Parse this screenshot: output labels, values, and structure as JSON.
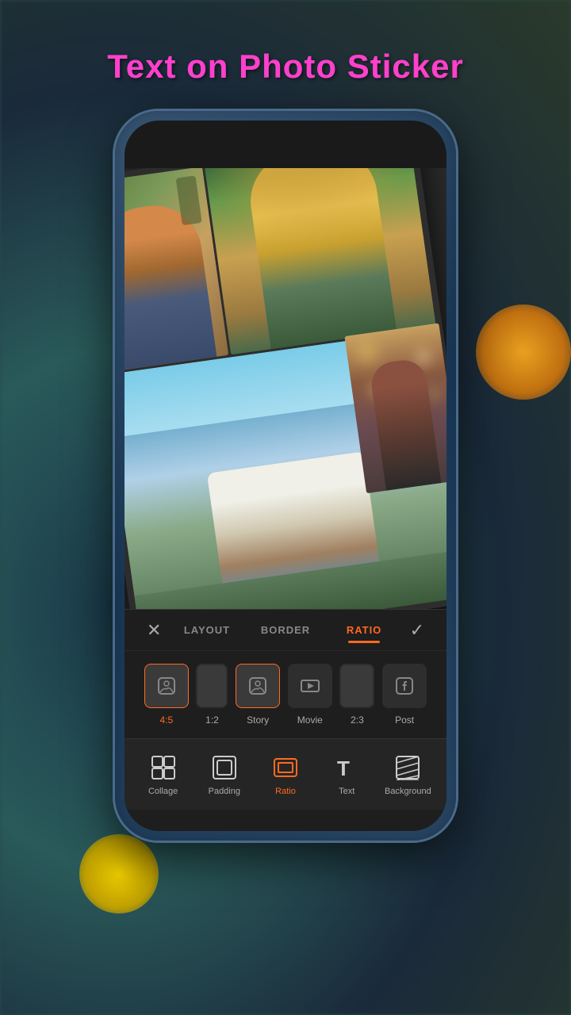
{
  "app": {
    "title": "Text on Photo Sticker",
    "title_color": "#ff40cc"
  },
  "tabs": {
    "layout": "LAYOUT",
    "border": "BORDER",
    "ratio": "RATIO",
    "active": "RATIO"
  },
  "ratio_options": [
    {
      "id": "4_5",
      "label": "4:5",
      "icon": "instagram"
    },
    {
      "id": "1_2",
      "label": "1:2",
      "icon": "rect-portrait"
    },
    {
      "id": "story",
      "label": "Story",
      "icon": "instagram2"
    },
    {
      "id": "movie",
      "label": "Movie",
      "icon": "movie"
    },
    {
      "id": "2_3",
      "label": "2:3",
      "icon": "rect-portrait2"
    },
    {
      "id": "post",
      "label": "Post",
      "icon": "facebook"
    }
  ],
  "bottom_nav": [
    {
      "id": "collage",
      "label": "Collage",
      "icon": "grid"
    },
    {
      "id": "padding",
      "label": "Padding",
      "icon": "square-border"
    },
    {
      "id": "ratio",
      "label": "Ratio",
      "icon": "square-ratio"
    },
    {
      "id": "text",
      "label": "Text",
      "icon": "text-t"
    },
    {
      "id": "background",
      "label": "Background",
      "icon": "background"
    }
  ],
  "icons": {
    "close": "✕",
    "check": "✓"
  }
}
